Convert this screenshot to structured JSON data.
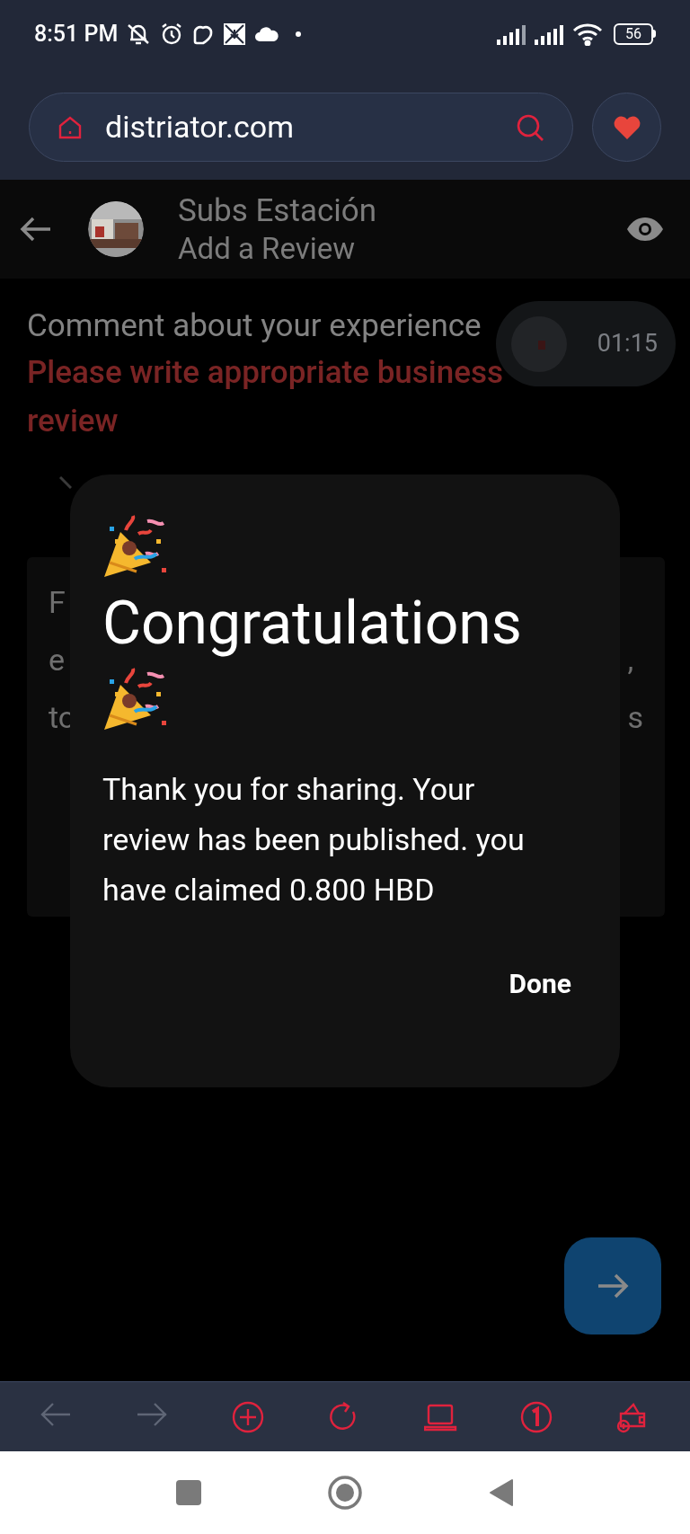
{
  "status_bar": {
    "time": "8:51 PM",
    "battery": "56"
  },
  "browser": {
    "url": "distriator.com"
  },
  "header": {
    "title": "Subs Estación",
    "subtitle": "Add a Review"
  },
  "form": {
    "label": "Comment about your experience",
    "warning": "Please write appropriate business review",
    "card_left_fragments": [
      "F",
      "e",
      "to"
    ],
    "card_right_fragments": [
      ",",
      "s"
    ]
  },
  "timer": {
    "time": "01:15"
  },
  "dialog": {
    "title": "Congratulations",
    "message": "Thank you for sharing. Your review has been published. you have claimed 0.800 HBD",
    "button": "Done"
  },
  "toolbar": {
    "items": [
      {
        "kind": "back",
        "disabled": true
      },
      {
        "kind": "forward",
        "disabled": true
      },
      {
        "kind": "add",
        "disabled": false
      },
      {
        "kind": "reload",
        "disabled": false
      },
      {
        "kind": "laptop",
        "disabled": false
      },
      {
        "kind": "tabs",
        "disabled": false
      },
      {
        "kind": "wallet",
        "disabled": false
      }
    ]
  }
}
